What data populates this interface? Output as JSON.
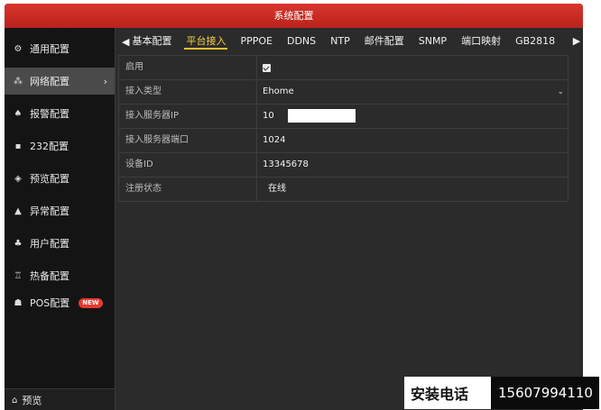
{
  "window": {
    "title": "系统配置"
  },
  "sidebar": {
    "items": [
      {
        "icon": "gear-icon",
        "glyph": "⚙",
        "label": "通用配置"
      },
      {
        "icon": "network-icon",
        "glyph": "⁂",
        "label": "网络配置",
        "active": true
      },
      {
        "icon": "alarm-icon",
        "glyph": "♠",
        "label": "报警配置"
      },
      {
        "icon": "rs232-icon",
        "glyph": "▪",
        "label": "232配置"
      },
      {
        "icon": "eye-icon",
        "glyph": "◈",
        "label": "预览配置"
      },
      {
        "icon": "warning-icon",
        "glyph": "▲",
        "label": "异常配置"
      },
      {
        "icon": "users-icon",
        "glyph": "♣",
        "label": "用户配置"
      },
      {
        "icon": "backup-icon",
        "glyph": "♖",
        "label": "热备配置"
      },
      {
        "icon": "pos-icon",
        "glyph": "☗",
        "label": "POS配置",
        "badge": "NEW"
      }
    ],
    "preview": {
      "icon": "home-icon",
      "glyph": "⌂",
      "label": "预览"
    }
  },
  "tabs": [
    {
      "label": "基本配置"
    },
    {
      "label": "平台接入",
      "active": true
    },
    {
      "label": "PPPOE"
    },
    {
      "label": "DDNS"
    },
    {
      "label": "NTP"
    },
    {
      "label": "邮件配置"
    },
    {
      "label": "SNMP"
    },
    {
      "label": "端口映射"
    },
    {
      "label": "GB2818"
    }
  ],
  "form": {
    "enable": {
      "label": "启用",
      "checked": true
    },
    "access_type": {
      "label": "接入类型",
      "value": "Ehome"
    },
    "server_ip": {
      "label": "接入服务器IP",
      "value": "10"
    },
    "server_port": {
      "label": "接入服务器端口",
      "value": "1024"
    },
    "device_id": {
      "label": "设备ID",
      "value": "13345678"
    },
    "register_status": {
      "label": "注册状态",
      "value": "在线"
    }
  },
  "overlay": {
    "label": "安装电话",
    "phone": "15607994110"
  }
}
